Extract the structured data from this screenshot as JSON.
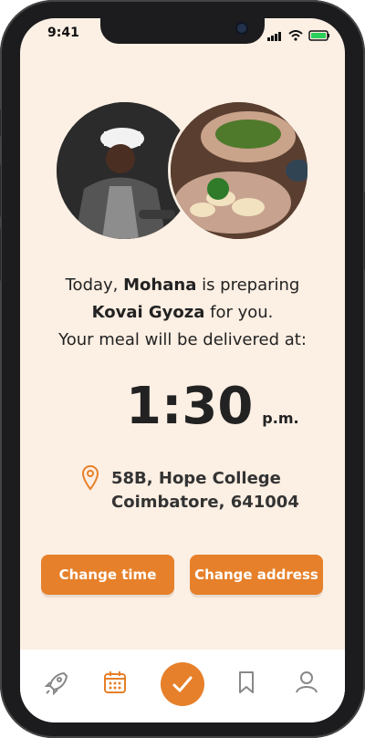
{
  "status_bar": {
    "time": "9:41"
  },
  "hero": {
    "line1_prefix": "Today, ",
    "chef_name": "Mohana",
    "line1_suffix": " is preparing",
    "dish_name": "Kovai Gyoza",
    "line2_suffix": " for you.",
    "line3": "Your meal will be delivered at:"
  },
  "delivery": {
    "time": "1:30",
    "ampm": "p.m."
  },
  "address": {
    "line1": "58B, Hope College",
    "line2": "Coimbatore, 641004"
  },
  "actions": {
    "change_time": "Change time",
    "change_address": "Change address"
  },
  "tabs": [
    {
      "icon": "rocket-icon"
    },
    {
      "icon": "calendar-icon"
    },
    {
      "icon": "check-icon"
    },
    {
      "icon": "bookmark-icon"
    },
    {
      "icon": "user-icon"
    }
  ],
  "colors": {
    "accent": "#e6802a",
    "background": "#fcefe3"
  }
}
